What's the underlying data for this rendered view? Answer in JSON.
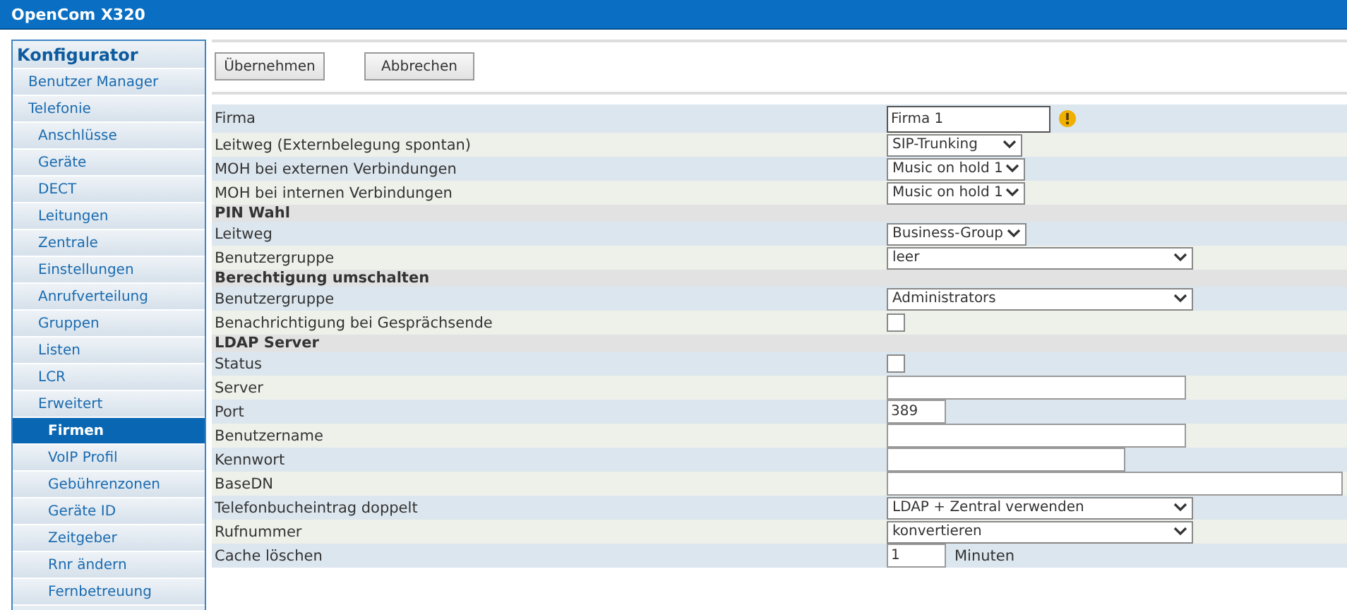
{
  "window": {
    "title": "OpenCom X320"
  },
  "sidebar": {
    "title": "Konfigurator",
    "items": [
      {
        "label": "Benutzer Manager",
        "selected": false
      },
      {
        "label": "Telefonie",
        "selected": false,
        "children": [
          {
            "label": "Anschlüsse",
            "selected": false
          },
          {
            "label": "Geräte",
            "selected": false
          },
          {
            "label": "DECT",
            "selected": false
          },
          {
            "label": "Leitungen",
            "selected": false
          },
          {
            "label": "Zentrale",
            "selected": false
          },
          {
            "label": "Einstellungen",
            "selected": false
          },
          {
            "label": "Anrufverteilung",
            "selected": false
          },
          {
            "label": "Gruppen",
            "selected": false
          },
          {
            "label": "Listen",
            "selected": false
          },
          {
            "label": "LCR",
            "selected": false
          },
          {
            "label": "Erweitert",
            "selected": false,
            "children": [
              {
                "label": "Firmen",
                "selected": true
              },
              {
                "label": "VoIP Profil",
                "selected": false
              },
              {
                "label": "Gebührenzonen",
                "selected": false
              },
              {
                "label": "Geräte ID",
                "selected": false
              },
              {
                "label": "Zeitgeber",
                "selected": false
              },
              {
                "label": "Rnr ändern",
                "selected": false
              },
              {
                "label": "Fernbetreuung",
                "selected": false
              }
            ]
          }
        ]
      }
    ]
  },
  "buttons": [
    "Übernehmen",
    "Abbrechen"
  ],
  "form": [
    {
      "kind": "field",
      "label": "Firma",
      "control": {
        "kind": "name-input",
        "value": "Firma 1",
        "warning": true
      }
    },
    {
      "kind": "field",
      "label": "Leitweg (Externbelegung spontan)",
      "control": {
        "kind": "compact-select",
        "value": "SIP-Trunking"
      }
    },
    {
      "kind": "field",
      "label": "MOH bei externen Verbindungen",
      "control": {
        "kind": "compact-select",
        "value": "Music on hold 1"
      }
    },
    {
      "kind": "field",
      "label": "MOH bei internen Verbindungen",
      "control": {
        "kind": "compact-select",
        "value": "Music on hold 1"
      }
    },
    {
      "kind": "section",
      "label": "PIN Wahl"
    },
    {
      "kind": "field",
      "label": "Leitweg",
      "control": {
        "kind": "compact-select",
        "value": "Business-Group"
      }
    },
    {
      "kind": "field",
      "label": "Benutzergruppe",
      "control": {
        "kind": "select",
        "value": "leer"
      }
    },
    {
      "kind": "section",
      "label": "Berechtigung umschalten"
    },
    {
      "kind": "field",
      "label": "Benutzergruppe",
      "control": {
        "kind": "select",
        "value": "Administrators"
      }
    },
    {
      "kind": "field",
      "label": "Benachrichtigung bei Gesprächsende",
      "control": {
        "kind": "checkbox",
        "checked": false
      }
    },
    {
      "kind": "section",
      "label": "LDAP Server"
    },
    {
      "kind": "field",
      "label": "Status",
      "control": {
        "kind": "checkbox",
        "checked": false
      }
    },
    {
      "kind": "field",
      "label": "Server",
      "control": {
        "kind": "text-input"
      }
    },
    {
      "kind": "field",
      "label": "Port",
      "control": {
        "kind": "number-input",
        "value": "389"
      }
    },
    {
      "kind": "field",
      "label": "Benutzername",
      "control": {
        "kind": "text-input"
      }
    },
    {
      "kind": "field",
      "label": "Kennwort",
      "control": {
        "kind": "password-input"
      }
    },
    {
      "kind": "field",
      "label": "BaseDN",
      "control": {
        "kind": "wide-input"
      }
    },
    {
      "kind": "field",
      "label": "Telefonbucheintrag doppelt",
      "control": {
        "kind": "select",
        "value": "LDAP + Zentral verwenden"
      }
    },
    {
      "kind": "field",
      "label": "Rufnummer",
      "control": {
        "kind": "select",
        "value": "konvertieren"
      }
    },
    {
      "kind": "field",
      "label": "Cache löschen",
      "control": {
        "kind": "number-input",
        "value": "1",
        "unit": "Minuten"
      }
    }
  ]
}
